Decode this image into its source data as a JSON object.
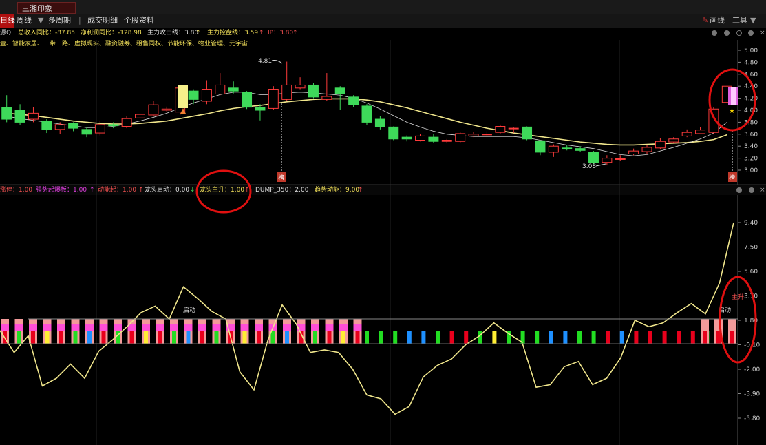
{
  "window": {
    "title_tab": "三湘印象"
  },
  "nav": {
    "day": "日线",
    "week": "周线",
    "multi": "多周期",
    "trades": "成交明细",
    "profile": "个股资料",
    "draw": "画线",
    "tools": "工具"
  },
  "infobar": {
    "code": "源Q",
    "revenue": "总收入同比：-87.85",
    "profit": "净利润同比：-128.98",
    "attack": "主力攻击线：3.80",
    "control": "主力控盘线：3.59",
    "ip": "IP：3.80"
  },
  "concepts": "壹、智能家居、一带一路、虚拟现实、融资融券、租售同权、节能环保、物业管理、元宇宙",
  "indicators": {
    "zhangting": "涨停：1.00",
    "pink": "强势起爆板：1.00",
    "red": "动能起：1.00",
    "qidong": "龙头启动：0.00",
    "zhusheng": "龙头主升：1.00",
    "dump": "DUMP_350：2.00",
    "shineng": "趋势动能：9.00"
  },
  "price_axis": [
    "5.00",
    "4.80",
    "4.60",
    "4.40",
    "4.20",
    "4.00",
    "3.80",
    "3.60",
    "3.40",
    "3.20",
    "3.00"
  ],
  "ind_axis": [
    "9.40",
    "7.50",
    "5.60",
    "3.70",
    "1.80",
    "-0.10",
    "-2.00",
    "-3.90",
    "-5.80"
  ],
  "annotations": {
    "high": "4.81",
    "low": "3.08",
    "qidong": "启动",
    "zhusheng": "主升",
    "badge": "榜"
  },
  "colors": {
    "up": "#ff3b3b",
    "down": "#3ed95a",
    "ma_yellow": "#f0e68c",
    "ma_white": "#dddddd",
    "circle": "#e01010",
    "text_yellow": "#f2e05a"
  },
  "chart_data": [
    {
      "type": "candlestick",
      "title": "",
      "xlabel": "",
      "ylabel": "",
      "ylim": [
        2.95,
        5.05
      ],
      "candles": [
        {
          "o": 4.05,
          "c": 3.85,
          "h": 4.25,
          "l": 3.8
        },
        {
          "o": 4.0,
          "c": 3.8,
          "h": 4.1,
          "l": 3.75
        },
        {
          "o": 3.85,
          "c": 3.95,
          "h": 4.05,
          "l": 3.8
        },
        {
          "o": 3.82,
          "c": 3.68,
          "h": 3.85,
          "l": 3.62
        },
        {
          "o": 3.68,
          "c": 3.76,
          "h": 3.8,
          "l": 3.6
        },
        {
          "o": 3.78,
          "c": 3.7,
          "h": 3.8,
          "l": 3.65
        },
        {
          "o": 3.68,
          "c": 3.6,
          "h": 3.72,
          "l": 3.55
        },
        {
          "o": 3.62,
          "c": 3.76,
          "h": 3.82,
          "l": 3.58
        },
        {
          "o": 3.76,
          "c": 3.74,
          "h": 3.8,
          "l": 3.7
        },
        {
          "o": 3.73,
          "c": 3.86,
          "h": 3.9,
          "l": 3.7
        },
        {
          "o": 3.87,
          "c": 3.93,
          "h": 3.98,
          "l": 3.84
        },
        {
          "o": 3.92,
          "c": 4.09,
          "h": 4.15,
          "l": 3.9
        },
        {
          "o": 4.0,
          "c": 4.02,
          "h": 4.06,
          "l": 3.97
        },
        {
          "o": 3.97,
          "c": 4.37,
          "h": 4.4,
          "l": 3.92
        },
        {
          "o": 4.32,
          "c": 4.18,
          "h": 4.35,
          "l": 4.1
        },
        {
          "o": 4.15,
          "c": 4.35,
          "h": 4.5,
          "l": 4.1
        },
        {
          "o": 4.27,
          "c": 4.42,
          "h": 4.62,
          "l": 4.25
        },
        {
          "o": 4.37,
          "c": 4.32,
          "h": 4.48,
          "l": 4.28
        },
        {
          "o": 4.3,
          "c": 4.05,
          "h": 4.32,
          "l": 4.02
        },
        {
          "o": 4.05,
          "c": 4.0,
          "h": 4.1,
          "l": 3.83
        },
        {
          "o": 4.03,
          "c": 4.35,
          "h": 4.4,
          "l": 4.0
        },
        {
          "o": 4.18,
          "c": 4.42,
          "h": 4.81,
          "l": 4.15
        },
        {
          "o": 4.37,
          "c": 4.42,
          "h": 4.55,
          "l": 4.35
        },
        {
          "o": 4.42,
          "c": 4.22,
          "h": 4.45,
          "l": 4.2
        },
        {
          "o": 4.18,
          "c": 4.23,
          "h": 4.62,
          "l": 4.15
        },
        {
          "o": 4.37,
          "c": 4.27,
          "h": 4.4,
          "l": 4.0
        },
        {
          "o": 4.22,
          "c": 4.09,
          "h": 4.25,
          "l": 4.05
        },
        {
          "o": 4.07,
          "c": 3.8,
          "h": 4.1,
          "l": 3.75
        },
        {
          "o": 3.85,
          "c": 3.72,
          "h": 3.9,
          "l": 3.68
        },
        {
          "o": 3.72,
          "c": 3.52,
          "h": 3.73,
          "l": 3.5
        },
        {
          "o": 3.55,
          "c": 3.52,
          "h": 3.58,
          "l": 3.48
        },
        {
          "o": 3.5,
          "c": 3.57,
          "h": 3.6,
          "l": 3.48
        },
        {
          "o": 3.55,
          "c": 3.48,
          "h": 3.6,
          "l": 3.46
        },
        {
          "o": 3.48,
          "c": 3.5,
          "h": 3.52,
          "l": 3.45
        },
        {
          "o": 3.48,
          "c": 3.61,
          "h": 3.64,
          "l": 3.45
        },
        {
          "o": 3.57,
          "c": 3.6,
          "h": 3.64,
          "l": 3.55
        },
        {
          "o": 3.6,
          "c": 3.6,
          "h": 3.65,
          "l": 3.55
        },
        {
          "o": 3.63,
          "c": 3.73,
          "h": 3.76,
          "l": 3.6
        },
        {
          "o": 3.7,
          "c": 3.7,
          "h": 3.72,
          "l": 3.62
        },
        {
          "o": 3.72,
          "c": 3.52,
          "h": 3.73,
          "l": 3.5
        },
        {
          "o": 3.49,
          "c": 3.3,
          "h": 3.5,
          "l": 3.25
        },
        {
          "o": 3.3,
          "c": 3.4,
          "h": 3.43,
          "l": 3.22
        },
        {
          "o": 3.37,
          "c": 3.35,
          "h": 3.42,
          "l": 3.33
        },
        {
          "o": 3.36,
          "c": 3.33,
          "h": 3.4,
          "l": 3.3
        },
        {
          "o": 3.3,
          "c": 3.13,
          "h": 3.32,
          "l": 3.1
        },
        {
          "o": 3.13,
          "c": 3.2,
          "h": 3.25,
          "l": 3.08
        },
        {
          "o": 3.18,
          "c": 3.19,
          "h": 3.25,
          "l": 3.15
        },
        {
          "o": 3.27,
          "c": 3.32,
          "h": 3.36,
          "l": 3.25
        },
        {
          "o": 3.31,
          "c": 3.38,
          "h": 3.42,
          "l": 3.27
        },
        {
          "o": 3.37,
          "c": 3.48,
          "h": 3.53,
          "l": 3.35
        },
        {
          "o": 3.47,
          "c": 3.52,
          "h": 3.55,
          "l": 3.45
        },
        {
          "o": 3.57,
          "c": 3.63,
          "h": 3.68,
          "l": 3.55
        },
        {
          "o": 3.61,
          "c": 3.67,
          "h": 3.72,
          "l": 3.6
        },
        {
          "o": 3.63,
          "c": 4.02,
          "h": 4.05,
          "l": 3.6
        },
        {
          "o": 4.13,
          "c": 4.4,
          "h": 4.4,
          "l": 4.13
        }
      ],
      "ma_yellow": [
        3.95,
        3.93,
        3.91,
        3.88,
        3.85,
        3.82,
        3.8,
        3.78,
        3.77,
        3.77,
        3.78,
        3.8,
        3.82,
        3.86,
        3.9,
        3.94,
        3.99,
        4.03,
        4.06,
        4.08,
        4.11,
        4.14,
        4.16,
        4.18,
        4.19,
        4.19,
        4.19,
        4.17,
        4.14,
        4.09,
        4.04,
        3.98,
        3.92,
        3.86,
        3.8,
        3.75,
        3.7,
        3.66,
        3.62,
        3.59,
        3.56,
        3.53,
        3.5,
        3.47,
        3.45,
        3.43,
        3.42,
        3.42,
        3.43,
        3.44,
        3.45,
        3.46,
        3.48,
        3.51,
        3.59
      ],
      "ma_white": [
        3.9,
        3.86,
        3.83,
        3.8,
        3.77,
        3.74,
        3.71,
        3.71,
        3.73,
        3.77,
        3.82,
        3.88,
        3.95,
        4.04,
        4.12,
        4.19,
        4.26,
        4.3,
        4.3,
        4.26,
        4.26,
        4.29,
        4.3,
        4.29,
        4.27,
        4.25,
        4.2,
        4.12,
        4.02,
        3.91,
        3.8,
        3.72,
        3.65,
        3.6,
        3.58,
        3.56,
        3.56,
        3.56,
        3.56,
        3.54,
        3.5,
        3.46,
        3.42,
        3.39,
        3.36,
        3.31,
        3.26,
        3.24,
        3.26,
        3.32,
        3.38,
        3.45,
        3.52,
        3.62,
        3.8
      ]
    },
    {
      "type": "line",
      "title": "",
      "ylim": [
        -5.8,
        9.4
      ],
      "series": [
        {
          "name": "趋势动能",
          "values": [
            1.0,
            -0.7,
            0.6,
            -3.3,
            -2.7,
            -1.6,
            -2.7,
            -0.6,
            0.3,
            1.3,
            2.4,
            2.9,
            1.9,
            4.4,
            3.5,
            2.5,
            1.9,
            -2.2,
            -3.6,
            0.3,
            3.0,
            1.5,
            -0.7,
            -0.5,
            -0.7,
            -2.0,
            -4.0,
            -4.3,
            -5.5,
            -4.9,
            -2.6,
            -1.7,
            -1.2,
            -0.1,
            0.6,
            1.6,
            0.8,
            0.1,
            -3.4,
            -3.2,
            -1.8,
            -1.4,
            -3.2,
            -2.7,
            -1.1,
            1.8,
            1.3,
            1.6,
            2.4,
            3.1,
            2.3,
            4.7,
            9.4
          ]
        }
      ]
    }
  ]
}
